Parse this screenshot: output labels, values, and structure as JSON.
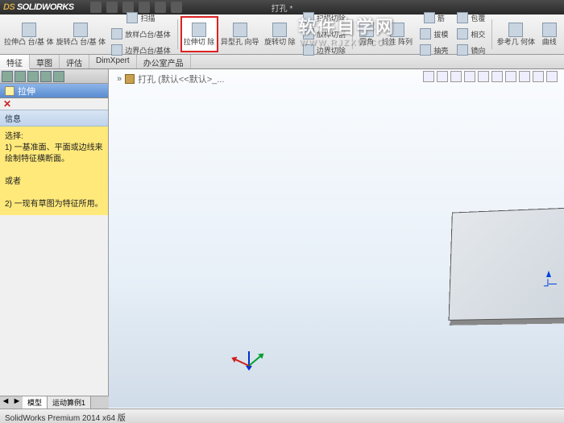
{
  "title": {
    "logo_ds": "DS",
    "logo_rest": " SOLIDWORKS",
    "doc": "打孔 *"
  },
  "ribbon": {
    "g1": [
      {
        "l": "拉伸凸\n台/基\n体"
      },
      {
        "l": "旋转凸\n台/基\n体"
      }
    ],
    "g1s": [
      {
        "l": "扫描"
      },
      {
        "l": "放样凸台/基体"
      },
      {
        "l": "边界凸台/基体"
      }
    ],
    "g2": [
      {
        "l": "拉伸切\n除",
        "hl": true
      },
      {
        "l": "异型孔\n向导"
      },
      {
        "l": "旋转切\n除"
      }
    ],
    "g2s": [
      {
        "l": "扫描切除"
      },
      {
        "l": "放样切割"
      },
      {
        "l": "边界切除"
      }
    ],
    "g3": [
      {
        "l": "圆角"
      },
      {
        "l": "线性\n阵列"
      }
    ],
    "g3s": [
      {
        "l": "筋"
      },
      {
        "l": "拔模"
      },
      {
        "l": "抽壳"
      }
    ],
    "g3s2": [
      {
        "l": "包覆"
      },
      {
        "l": "相交"
      },
      {
        "l": "镜向"
      }
    ],
    "g4": [
      {
        "l": "参考几\n何体"
      },
      {
        "l": "曲线"
      }
    ]
  },
  "tabs": [
    "特征",
    "草图",
    "评估",
    "DimXpert",
    "办公室产品"
  ],
  "activeTab": 0,
  "pm": {
    "title": "拉伸",
    "sec": "信息",
    "body": "选择:\n1) 一基准面、平面或边线来绘制特征横断面。\n\n或者\n\n2) 一现有草图为特征所用。"
  },
  "breadcrumb": "打孔 (默认<<默认>_...",
  "btabs": [
    "模型",
    "运动算例1"
  ],
  "status": "SolidWorks Premium 2014 x64 版",
  "watermark": {
    "t": "软件自学网",
    "u": "WWW.RJZXW.COM"
  }
}
